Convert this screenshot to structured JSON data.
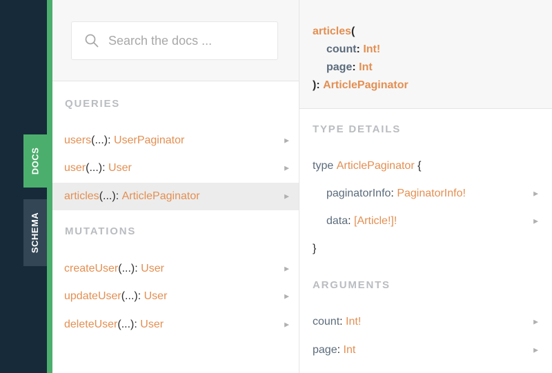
{
  "sidebar": {
    "tabs": [
      {
        "label": "DOCS",
        "active": true
      },
      {
        "label": "SCHEMA",
        "active": false
      }
    ]
  },
  "search": {
    "placeholder": "Search the docs ..."
  },
  "queries": {
    "title": "QUERIES",
    "items": [
      {
        "name": "users",
        "args": "(...)",
        "colon": ":",
        "type": "UserPaginator"
      },
      {
        "name": "user",
        "args": "(...)",
        "colon": ":",
        "type": "User"
      },
      {
        "name": "articles",
        "args": "(...)",
        "colon": ":",
        "type": "ArticlePaginator",
        "selected": true
      }
    ]
  },
  "mutations": {
    "title": "MUTATIONS",
    "items": [
      {
        "name": "createUser",
        "args": "(...)",
        "colon": ":",
        "type": "User"
      },
      {
        "name": "updateUser",
        "args": "(...)",
        "colon": ":",
        "type": "User"
      },
      {
        "name": "deleteUser",
        "args": "(...)",
        "colon": ":",
        "type": "User"
      }
    ]
  },
  "signature": {
    "name": "articles",
    "open": "(",
    "args": [
      {
        "name": "count",
        "colon": ":",
        "type": "Int!"
      },
      {
        "name": "page",
        "colon": ":",
        "type": "Int"
      }
    ],
    "close": "):",
    "return_type": "ArticlePaginator"
  },
  "type_details": {
    "title": "TYPE DETAILS",
    "keyword": "type",
    "type_name": "ArticlePaginator",
    "open_brace": "{",
    "fields": [
      {
        "name": "paginatorInfo",
        "colon": ":",
        "type": "PaginatorInfo!"
      },
      {
        "name": "data",
        "colon": ":",
        "type": "[Article!]!"
      }
    ],
    "close_brace": "}"
  },
  "arguments": {
    "title": "ARGUMENTS",
    "items": [
      {
        "name": "count",
        "colon": ":",
        "type": "Int!"
      },
      {
        "name": "page",
        "colon": ":",
        "type": "Int"
      }
    ]
  },
  "icons": {
    "search": "search-icon",
    "expand": "triangle-right-icon"
  },
  "colors": {
    "rail": "#172a3a",
    "accent_green": "#4cae6d",
    "schema_tab": "#334655",
    "name_orange": "#e38f52",
    "field_slate": "#5b6b7b",
    "section_gray": "#b9bcc0"
  }
}
